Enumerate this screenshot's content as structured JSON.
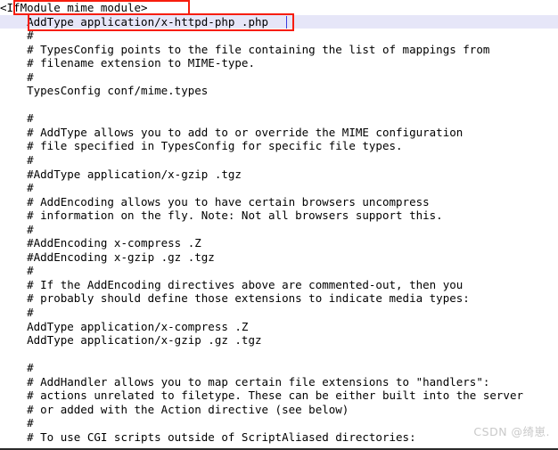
{
  "document": {
    "type": "apache-httpd-config",
    "highlight_color": "#e6e6f8",
    "annotation_color": "#f71d0d",
    "text_color": "#000000",
    "background_color": "#ffffff",
    "lines": [
      {
        "text": "<IfModule mime_module>",
        "highlighted": false
      },
      {
        "text": "    AddType application/x-httpd-php .php",
        "highlighted": true
      },
      {
        "text": "    #",
        "highlighted": false
      },
      {
        "text": "    # TypesConfig points to the file containing the list of mappings from",
        "highlighted": false
      },
      {
        "text": "    # filename extension to MIME-type.",
        "highlighted": false
      },
      {
        "text": "    #",
        "highlighted": false
      },
      {
        "text": "    TypesConfig conf/mime.types",
        "highlighted": false
      },
      {
        "text": "",
        "highlighted": false
      },
      {
        "text": "    #",
        "highlighted": false
      },
      {
        "text": "    # AddType allows you to add to or override the MIME configuration",
        "highlighted": false
      },
      {
        "text": "    # file specified in TypesConfig for specific file types.",
        "highlighted": false
      },
      {
        "text": "    #",
        "highlighted": false
      },
      {
        "text": "    #AddType application/x-gzip .tgz",
        "highlighted": false
      },
      {
        "text": "    #",
        "highlighted": false
      },
      {
        "text": "    # AddEncoding allows you to have certain browsers uncompress",
        "highlighted": false
      },
      {
        "text": "    # information on the fly. Note: Not all browsers support this.",
        "highlighted": false
      },
      {
        "text": "    #",
        "highlighted": false
      },
      {
        "text": "    #AddEncoding x-compress .Z",
        "highlighted": false
      },
      {
        "text": "    #AddEncoding x-gzip .gz .tgz",
        "highlighted": false
      },
      {
        "text": "    #",
        "highlighted": false
      },
      {
        "text": "    # If the AddEncoding directives above are commented-out, then you",
        "highlighted": false
      },
      {
        "text": "    # probably should define those extensions to indicate media types:",
        "highlighted": false
      },
      {
        "text": "    #",
        "highlighted": false
      },
      {
        "text": "    AddType application/x-compress .Z",
        "highlighted": false
      },
      {
        "text": "    AddType application/x-gzip .gz .tgz",
        "highlighted": false
      },
      {
        "text": "",
        "highlighted": false
      },
      {
        "text": "    #",
        "highlighted": false
      },
      {
        "text": "    # AddHandler allows you to map certain file extensions to \"handlers\":",
        "highlighted": false
      },
      {
        "text": "    # actions unrelated to filetype. These can be either built into the server",
        "highlighted": false
      },
      {
        "text": "    # or added with the Action directive (see below)",
        "highlighted": false
      },
      {
        "text": "    #",
        "highlighted": false
      },
      {
        "text": "    # To use CGI scripts outside of ScriptAliased directories:",
        "highlighted": false
      }
    ]
  },
  "annotations": [
    {
      "name": "ifmodule-highlight-box",
      "target": "<IfModule mime_module>"
    },
    {
      "name": "addtype-highlight-box",
      "target": "AddType application/x-httpd-php .php"
    }
  ],
  "watermark": {
    "text": "CSDN @绮崽."
  }
}
